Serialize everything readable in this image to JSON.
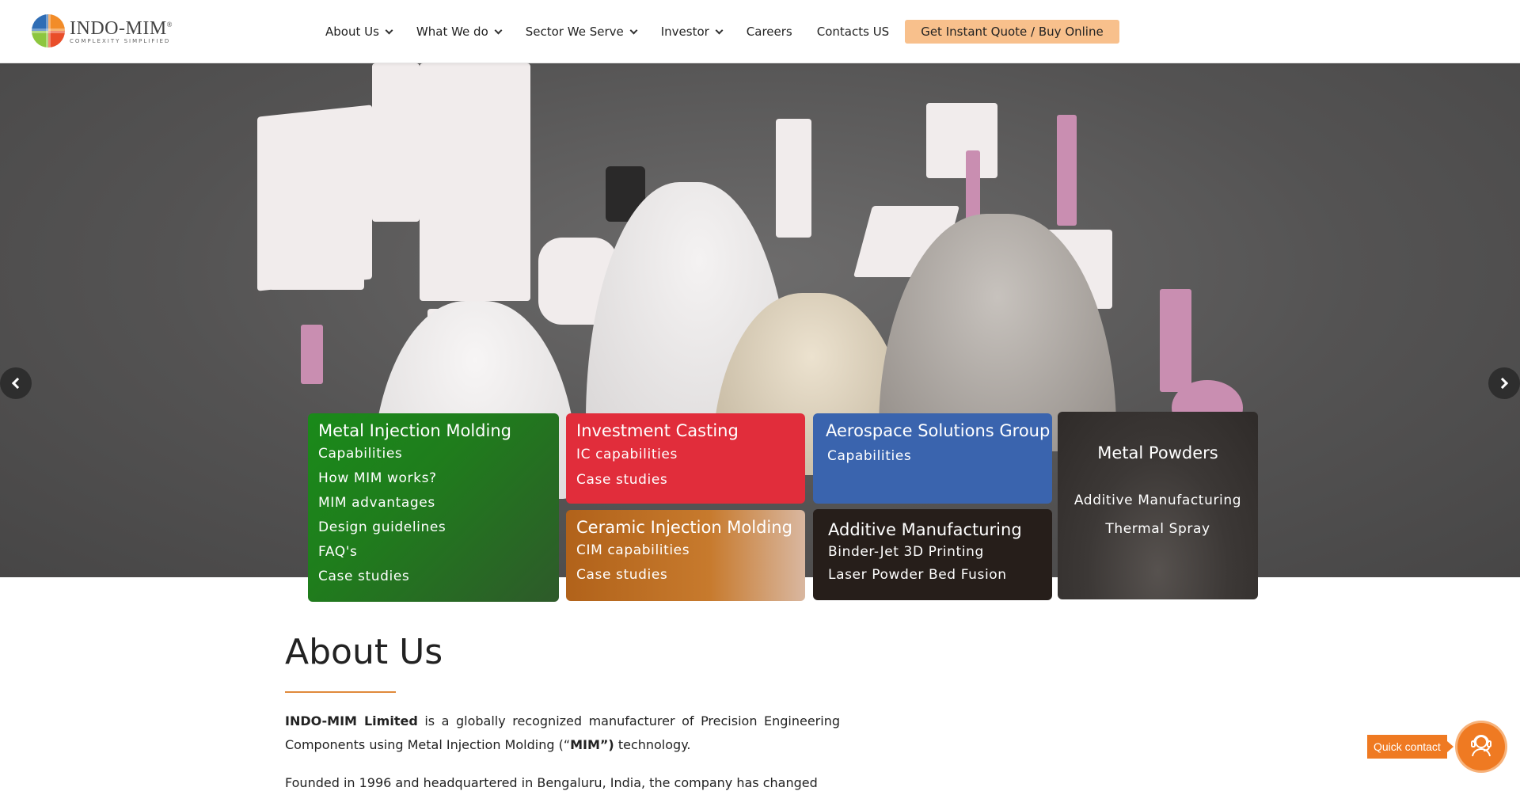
{
  "brand": {
    "name": "INDO-MIM",
    "registered": "®",
    "tagline": "COMPLEXITY SIMPLIFIED"
  },
  "nav": {
    "items": [
      {
        "label": "About Us",
        "has_dropdown": true
      },
      {
        "label": "What We do",
        "has_dropdown": true
      },
      {
        "label": "Sector We Serve",
        "has_dropdown": true
      },
      {
        "label": "Investor",
        "has_dropdown": true
      },
      {
        "label": "Careers",
        "has_dropdown": false
      },
      {
        "label": "Contacts US",
        "has_dropdown": false
      }
    ],
    "cta": "Get Instant Quote / Buy Online"
  },
  "hero": {
    "cards": {
      "mim": {
        "title": "Metal Injection Molding",
        "links": [
          "Capabilities",
          "How MIM works?",
          "MIM advantages",
          "Design guidelines",
          "FAQ's",
          "Case studies"
        ],
        "color": "#1a8a1a"
      },
      "ic": {
        "title": "Investment Casting",
        "links": [
          "IC capabilities",
          "Case studies"
        ],
        "color": "#e12d3b"
      },
      "cim": {
        "title": "Ceramic Injection Molding",
        "links": [
          "CIM capabilities",
          "Case studies"
        ],
        "color": "#b1621a"
      },
      "asg": {
        "title": "Aerospace Solutions Group",
        "links": [
          "Capabilities"
        ],
        "color": "#3a64ae"
      },
      "am": {
        "title": "Additive Manufacturing",
        "links": [
          "Binder-Jet 3D Printing",
          "Laser Powder Bed Fusion"
        ],
        "color": "#261e1a"
      },
      "mp": {
        "title": "Metal Powders",
        "links": [
          "Additive Manufacturing",
          "Thermal Spray"
        ],
        "color": "#3c3836"
      }
    },
    "icons": {
      "prev": "chevron-left-icon",
      "next": "chevron-right-icon"
    }
  },
  "about": {
    "title": "About Us",
    "p1_bold": "INDO-MIM Limited",
    "p1_a": " is a globally recognized manufacturer of Precision Engineering Components using Metal Injection Molding (“",
    "p1_bold2": "MIM”)",
    "p1_b": " technology.",
    "p2": "Founded in 1996 and headquartered in Bengaluru, India, the company has changed"
  },
  "quick_contact": {
    "label": "Quick contact",
    "icon": "support-agent-icon",
    "accent": "#ef7a22"
  }
}
